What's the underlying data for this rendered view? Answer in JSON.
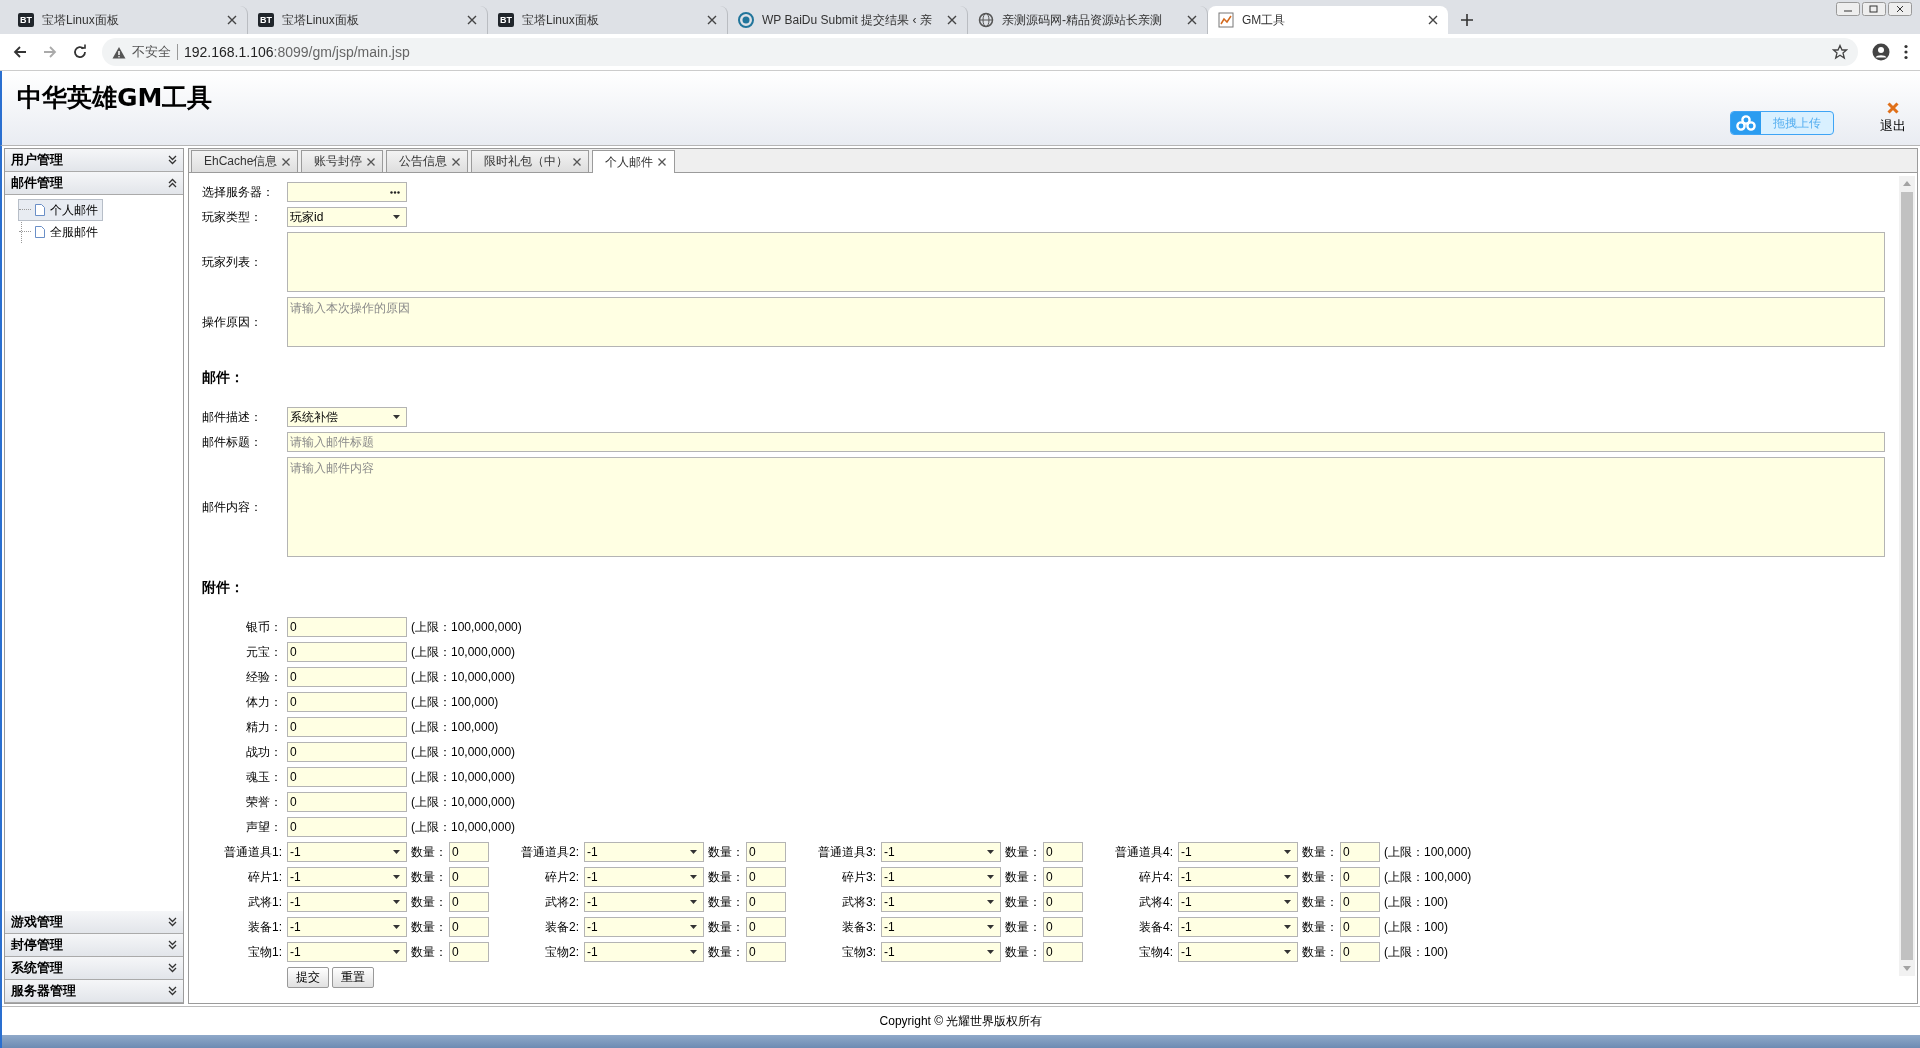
{
  "browser": {
    "tabs": [
      {
        "kind": "bt",
        "badge": "BT",
        "title": "宝塔Linux面板",
        "selected": false
      },
      {
        "kind": "bt",
        "badge": "BT",
        "title": "宝塔Linux面板",
        "selected": false
      },
      {
        "kind": "bt",
        "badge": "BT",
        "title": "宝塔Linux面板",
        "selected": false
      },
      {
        "kind": "wp",
        "title": "WP BaiDu Submit 提交结果 ‹ 亲",
        "selected": false
      },
      {
        "kind": "globe",
        "title": "亲测源码网-精品资源站长亲测",
        "selected": false
      },
      {
        "kind": "chart",
        "title": "GM工具",
        "selected": true
      }
    ],
    "security": "不安全",
    "url_host": "192.168.1.106",
    "url_rest": ":8099/gm/jsp/main.jsp"
  },
  "header": {
    "title": "中华英雄GM工具",
    "upload_button": "拖拽上传",
    "logout": "退出"
  },
  "sidebar": {
    "sections": [
      {
        "title": "用户管理",
        "expanded": false
      },
      {
        "title": "邮件管理",
        "expanded": true,
        "items": [
          {
            "label": "个人邮件",
            "selected": true
          },
          {
            "label": "全服邮件",
            "selected": false
          }
        ]
      },
      {
        "title": "游戏管理",
        "expanded": false
      },
      {
        "title": "封停管理",
        "expanded": false
      },
      {
        "title": "系统管理",
        "expanded": false
      },
      {
        "title": "服务器管理",
        "expanded": false
      }
    ]
  },
  "tabs": [
    {
      "label": "EhCache信息",
      "selected": false
    },
    {
      "label": "账号封停",
      "selected": false
    },
    {
      "label": "公告信息",
      "selected": false
    },
    {
      "label": "限时礼包（中）",
      "selected": false
    },
    {
      "label": "个人邮件",
      "selected": true
    }
  ],
  "form": {
    "fields": [
      {
        "kind": "picker",
        "label": "选择服务器："
      },
      {
        "kind": "select",
        "label": "玩家类型：",
        "value": "玩家id"
      },
      {
        "kind": "textarea",
        "label": "玩家列表："
      },
      {
        "kind": "reason",
        "label": "操作原因：",
        "placeholder": "请输入本次操作的原因"
      }
    ],
    "mail_heading": "邮件：",
    "mail_fields": [
      {
        "kind": "select",
        "label": "邮件描述：",
        "value": "系统补偿"
      },
      {
        "kind": "input",
        "label": "邮件标题：",
        "placeholder": "请输入邮件标题"
      },
      {
        "kind": "content",
        "label": "邮件内容：",
        "placeholder": "请输入邮件内容"
      }
    ],
    "attachments_heading": "附件：",
    "resources": [
      {
        "label": "银币：",
        "value": "0",
        "limit": "(上限：100,000,000)"
      },
      {
        "label": "元宝：",
        "value": "0",
        "limit": "(上限：10,000,000)"
      },
      {
        "label": "经验：",
        "value": "0",
        "limit": "(上限：10,000,000)"
      },
      {
        "label": "体力：",
        "value": "0",
        "limit": "(上限：100,000)"
      },
      {
        "label": "精力：",
        "value": "0",
        "limit": "(上限：100,000)"
      },
      {
        "label": "战功：",
        "value": "0",
        "limit": "(上限：10,000,000)"
      },
      {
        "label": "魂玉：",
        "value": "0",
        "limit": "(上限：10,000,000)"
      },
      {
        "label": "荣誉：",
        "value": "0",
        "limit": "(上限：10,000,000)"
      },
      {
        "label": "声望：",
        "value": "0",
        "limit": "(上限：10,000,000)"
      }
    ],
    "item_rows": [
      {
        "limit": "(上限：100,000)",
        "cells": [
          {
            "label": "普通道具1:",
            "value": "-1",
            "qty_label": "数量：",
            "qty": "0"
          },
          {
            "label": "普通道具2:",
            "value": "-1",
            "qty_label": "数量：",
            "qty": "0"
          },
          {
            "label": "普通道具3:",
            "value": "-1",
            "qty_label": "数量：",
            "qty": "0"
          },
          {
            "label": "普通道具4:",
            "value": "-1",
            "qty_label": "数量：",
            "qty": "0"
          }
        ]
      },
      {
        "limit": "(上限：100,000)",
        "cells": [
          {
            "label": "碎片1:",
            "value": "-1",
            "qty_label": "数量：",
            "qty": "0"
          },
          {
            "label": "碎片2:",
            "value": "-1",
            "qty_label": "数量：",
            "qty": "0"
          },
          {
            "label": "碎片3:",
            "value": "-1",
            "qty_label": "数量：",
            "qty": "0"
          },
          {
            "label": "碎片4:",
            "value": "-1",
            "qty_label": "数量：",
            "qty": "0"
          }
        ]
      },
      {
        "limit": "(上限：100)",
        "cells": [
          {
            "label": "武将1:",
            "value": "-1",
            "qty_label": "数量：",
            "qty": "0"
          },
          {
            "label": "武将2:",
            "value": "-1",
            "qty_label": "数量：",
            "qty": "0"
          },
          {
            "label": "武将3:",
            "value": "-1",
            "qty_label": "数量：",
            "qty": "0"
          },
          {
            "label": "武将4:",
            "value": "-1",
            "qty_label": "数量：",
            "qty": "0"
          }
        ]
      },
      {
        "limit": "(上限：100)",
        "cells": [
          {
            "label": "装备1:",
            "value": "-1",
            "qty_label": "数量：",
            "qty": "0"
          },
          {
            "label": "装备2:",
            "value": "-1",
            "qty_label": "数量：",
            "qty": "0"
          },
          {
            "label": "装备3:",
            "value": "-1",
            "qty_label": "数量：",
            "qty": "0"
          },
          {
            "label": "装备4:",
            "value": "-1",
            "qty_label": "数量：",
            "qty": "0"
          }
        ]
      },
      {
        "limit": "(上限：100)",
        "cells": [
          {
            "label": "宝物1:",
            "value": "-1",
            "qty_label": "数量：",
            "qty": "0"
          },
          {
            "label": "宝物2:",
            "value": "-1",
            "qty_label": "数量：",
            "qty": "0"
          },
          {
            "label": "宝物3:",
            "value": "-1",
            "qty_label": "数量：",
            "qty": "0"
          },
          {
            "label": "宝物4:",
            "value": "-1",
            "qty_label": "数量：",
            "qty": "0"
          }
        ]
      }
    ],
    "buttons": [
      "提交",
      "重置"
    ]
  },
  "footer": "Copyright © 光耀世界版权所有"
}
